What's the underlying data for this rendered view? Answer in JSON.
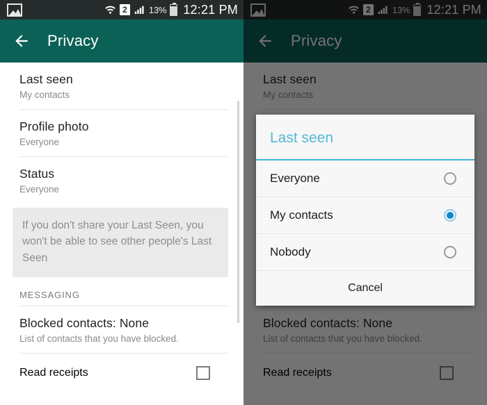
{
  "status_bar": {
    "notification_icon": "photo-icon",
    "wifi_icon": "wifi-icon",
    "sim_badge": "2",
    "signal_icon": "signal-bars-icon",
    "battery_percent": "13%",
    "battery_icon": "battery-icon",
    "time": "12:21 PM"
  },
  "app_bar": {
    "back_icon": "back-arrow-icon",
    "title": "Privacy"
  },
  "list": {
    "items": [
      {
        "title": "Last seen",
        "sub": "My contacts"
      },
      {
        "title": "Profile photo",
        "sub": "Everyone"
      },
      {
        "title": "Status",
        "sub": "Everyone"
      }
    ],
    "notice": "If you don't share your Last Seen, you won't be able to see other people's Last Seen",
    "section_header": "MESSAGING",
    "blocked": {
      "title": "Blocked contacts: None",
      "sub": "List of contacts that you have blocked."
    },
    "read_receipts": {
      "title": "Read receipts",
      "checked": false
    }
  },
  "dialog": {
    "title": "Last seen",
    "options": [
      {
        "label": "Everyone",
        "selected": false
      },
      {
        "label": "My contacts",
        "selected": true
      },
      {
        "label": "Nobody",
        "selected": false
      }
    ],
    "cancel_label": "Cancel"
  },
  "colors": {
    "app_bar": "#0c6157",
    "status_bar": "#262b2b",
    "dialog_accent": "#3fb6d6",
    "radio_selected": "#1186c8",
    "notice_bg": "#eaeaea"
  }
}
